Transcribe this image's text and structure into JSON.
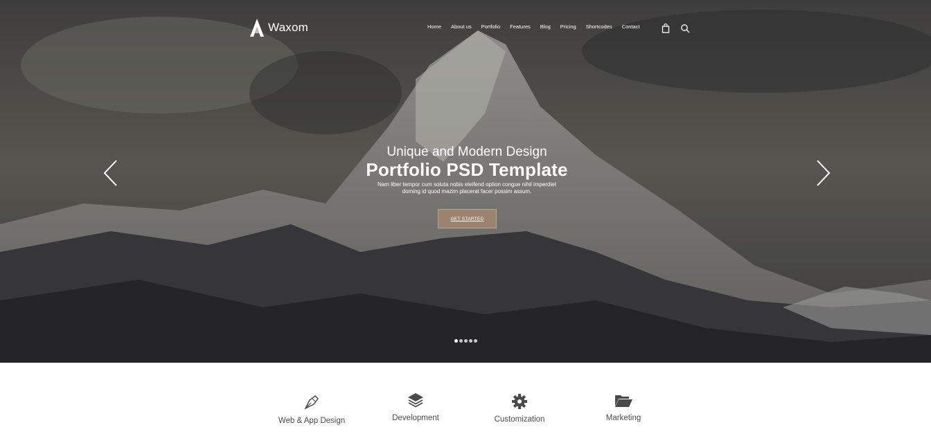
{
  "brand": {
    "name": "Waxom"
  },
  "nav": {
    "items": [
      "Home",
      "About us",
      "Portfolio",
      "Features",
      "Blog",
      "Pricing",
      "Shortcodes",
      "Contact"
    ]
  },
  "icons": {
    "cart": "shopping-bag-icon",
    "search": "search-icon",
    "prev": "chevron-left-icon",
    "next": "chevron-right-icon"
  },
  "hero": {
    "subtitle": "Unique and Modern Design",
    "title": "Portfolio PSD Template",
    "description": "Nam liber tempor cum soluta nobis eleifend option congue nihil imperdiet doming id quod mazim placerat facer possim assum.",
    "cta": "GET STARTED",
    "slides": 5,
    "active_slide": 1
  },
  "features": [
    {
      "label": "Web & App Design",
      "icon": "pen-nib-icon"
    },
    {
      "label": "Development",
      "icon": "layers-icon"
    },
    {
      "label": "Customization",
      "icon": "gear-icon"
    },
    {
      "label": "Marketing",
      "icon": "folder-open-icon"
    }
  ],
  "colors": {
    "accent": "#9a8470",
    "text": "#4a4a4a",
    "hero_overlay": "#2f3033"
  }
}
